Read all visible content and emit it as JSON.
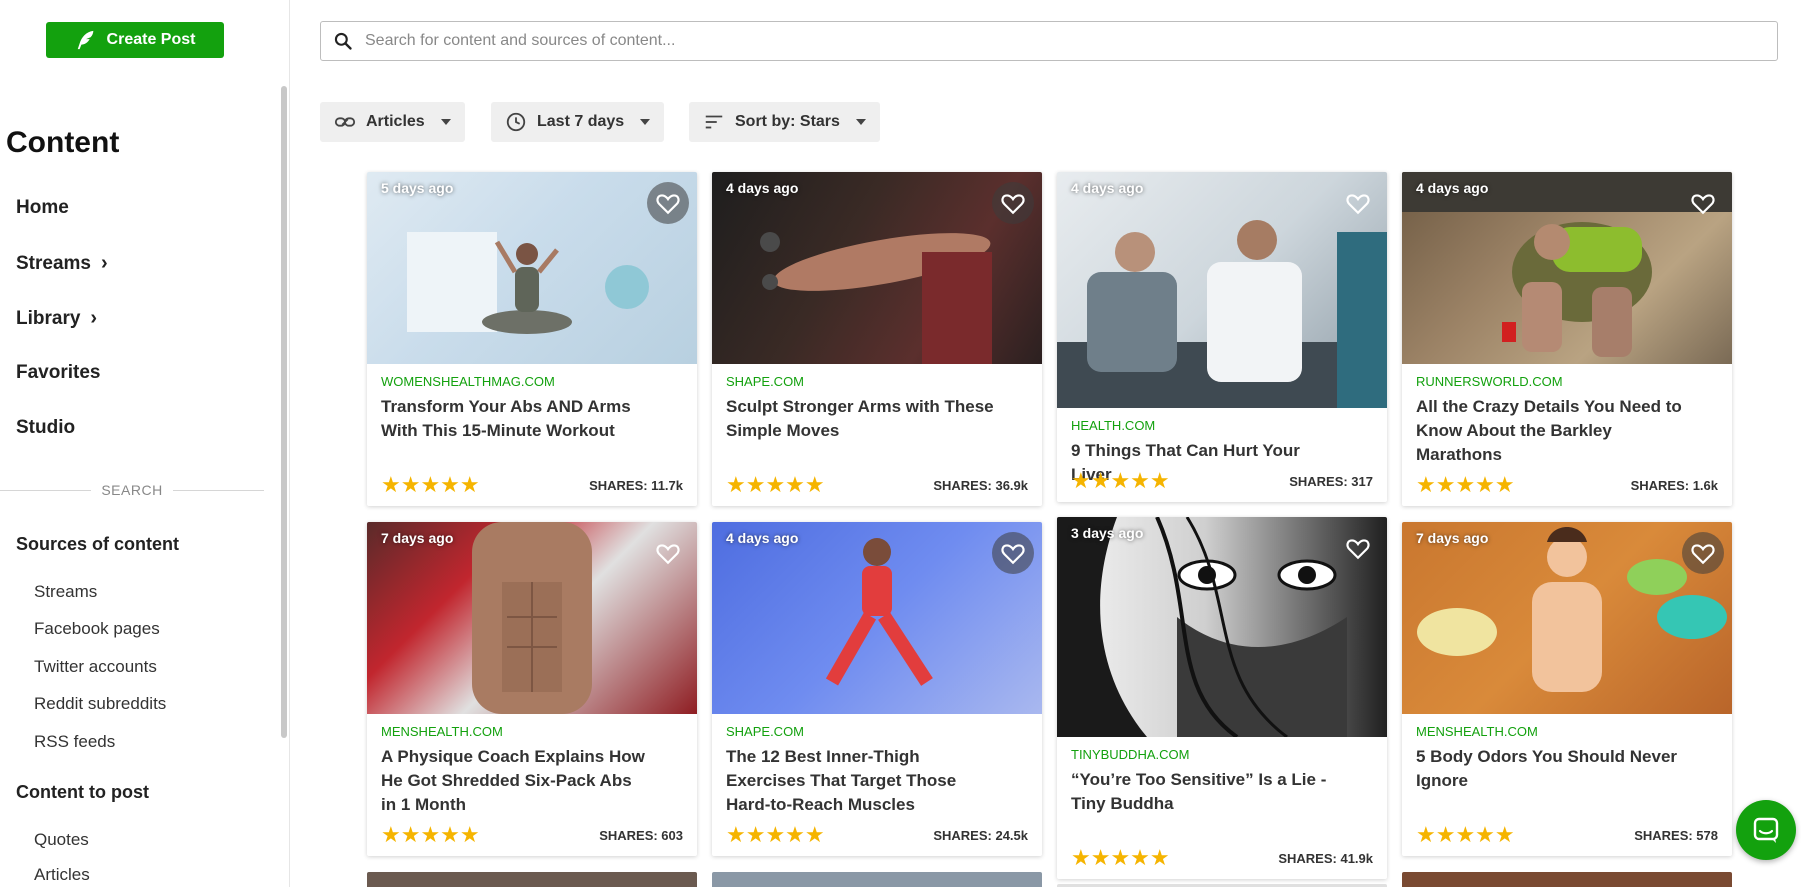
{
  "create_button": {
    "label": "Create Post"
  },
  "sidebar": {
    "title": "Content",
    "nav": [
      {
        "label": "Home"
      },
      {
        "label": "Streams"
      },
      {
        "label": "Library"
      },
      {
        "label": "Favorites"
      },
      {
        "label": "Studio"
      }
    ],
    "search_label": "SEARCH",
    "sources_heading": "Sources of content",
    "sources": [
      {
        "label": "Streams"
      },
      {
        "label": "Facebook pages"
      },
      {
        "label": "Twitter accounts"
      },
      {
        "label": "Reddit subreddits"
      },
      {
        "label": "RSS feeds"
      }
    ],
    "post_heading": "Content to post",
    "post_items": [
      {
        "label": "Quotes"
      },
      {
        "label": "Articles"
      }
    ]
  },
  "search": {
    "placeholder": "Search for content and sources of content..."
  },
  "filters": {
    "type": "Articles",
    "range": "Last 7 days",
    "sort": "Sort by: Stars"
  },
  "cards": [
    {
      "age": "5 days ago",
      "source": "WOMENSHEALTHMAG.COM",
      "title": "Transform Your Abs AND Arms With This 15-Minute Workout",
      "rating": 5,
      "stars": "★★★★★",
      "shares": "SHARES: 11.7k"
    },
    {
      "age": "4 days ago",
      "source": "SHAPE.COM",
      "title": "Sculpt Stronger Arms with These Simple Moves",
      "rating": 5,
      "stars": "★★★★★",
      "shares": "SHARES: 36.9k"
    },
    {
      "age": "4 days ago",
      "source": "HEALTH.COM",
      "title": "9 Things That Can Hurt Your Liver",
      "rating": 5,
      "stars": "★★★★★",
      "shares": "SHARES: 317"
    },
    {
      "age": "4 days ago",
      "source": "RUNNERSWORLD.COM",
      "title": "All the Crazy Details You Need to Know About the Barkley Marathons",
      "rating": 5,
      "stars": "★★★★★",
      "shares": "SHARES: 1.6k"
    },
    {
      "age": "7 days ago",
      "source": "MENSHEALTH.COM",
      "title": "A Physique Coach Explains How He Got Shredded Six-Pack Abs in 1 Month",
      "rating": 5,
      "stars": "★★★★★",
      "shares": "SHARES: 603"
    },
    {
      "age": "4 days ago",
      "source": "SHAPE.COM",
      "title": "The 12 Best Inner-Thigh Exercises That Target Those Hard-to-Reach Muscles",
      "rating": 5,
      "stars": "★★★★★",
      "shares": "SHARES: 24.5k"
    },
    {
      "age": "3 days ago",
      "source": "TINYBUDDHA.COM",
      "title": "“You’re Too Sensitive” Is a Lie - Tiny Buddha",
      "rating": 5,
      "stars": "★★★★★",
      "shares": "SHARES: 41.9k"
    },
    {
      "age": "7 days ago",
      "source": "MENSHEALTH.COM",
      "title": "5 Body Odors You Should Never Ignore",
      "rating": 5,
      "stars": "★★★★★",
      "shares": "SHARES: 578"
    }
  ],
  "colors": {
    "brand_green": "#13a10e",
    "star": "#f5b400"
  },
  "icons": [
    "feather-icon",
    "search-icon",
    "link-icon",
    "clock-icon",
    "sort-icon",
    "heart-icon",
    "chevron-right-icon",
    "chat-icon"
  ]
}
